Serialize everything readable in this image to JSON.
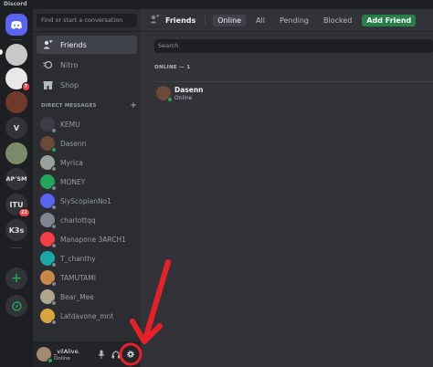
{
  "window": {
    "title": "Discord"
  },
  "servers": [
    {
      "name": "discord-home",
      "label": ""
    },
    {
      "name": "server-1",
      "label": ""
    },
    {
      "name": "server-2",
      "label": "",
      "badge": "7"
    },
    {
      "name": "server-3",
      "label": ""
    },
    {
      "name": "server-v",
      "label": "V"
    },
    {
      "name": "server-5",
      "label": ""
    },
    {
      "name": "server-apsm",
      "label": "AP'SM"
    },
    {
      "name": "server-itu",
      "label": "ITU",
      "badge": "22"
    },
    {
      "name": "server-k3s",
      "label": "K3s"
    }
  ],
  "sidebar": {
    "search_placeholder": "Find or start a conversation",
    "nav": [
      {
        "label": "Friends",
        "icon": "friends-icon"
      },
      {
        "label": "Nitro",
        "icon": "nitro-icon"
      },
      {
        "label": "Shop",
        "icon": "shop-icon"
      }
    ],
    "dm_header": "DIRECT MESSAGES",
    "dm_add": "+",
    "dms": [
      {
        "name": "KEMU",
        "color": "#3b3d44",
        "online": false
      },
      {
        "name": "Dasenn",
        "color": "#6b4a3a",
        "online": true
      },
      {
        "name": "Myrica",
        "color": "#9aa09a",
        "online": false
      },
      {
        "name": "MONEY",
        "color": "#23a559",
        "online": false
      },
      {
        "name": "SlyScopianNo1",
        "color": "#5865f2",
        "online": false
      },
      {
        "name": "charlottqq",
        "color": "#80848e",
        "online": false
      },
      {
        "name": "Manapone 3ARCH1",
        "color": "#f23f43",
        "online": false
      },
      {
        "name": "T_chanthy",
        "color": "#1aa7a7",
        "online": false
      },
      {
        "name": "TAMUTAMI",
        "color": "#c9884a",
        "online": false
      },
      {
        "name": "Bear_Mee",
        "color": "#b0a690",
        "online": false
      },
      {
        "name": "Latdavone_mnt",
        "color": "#d9a441",
        "online": false
      }
    ]
  },
  "user": {
    "name": "_vilAlive.",
    "status": "Online"
  },
  "main": {
    "title": "Friends",
    "tabs": [
      "Online",
      "All",
      "Pending",
      "Blocked"
    ],
    "add_friend": "Add Friend",
    "search_placeholder": "Search",
    "online_header": "ONLINE — 1",
    "friends": [
      {
        "name": "Dasenn",
        "status": "Online"
      }
    ]
  },
  "colors": {
    "accent": "#5865f2",
    "online": "#23a559",
    "annotation": "#e8202a"
  }
}
